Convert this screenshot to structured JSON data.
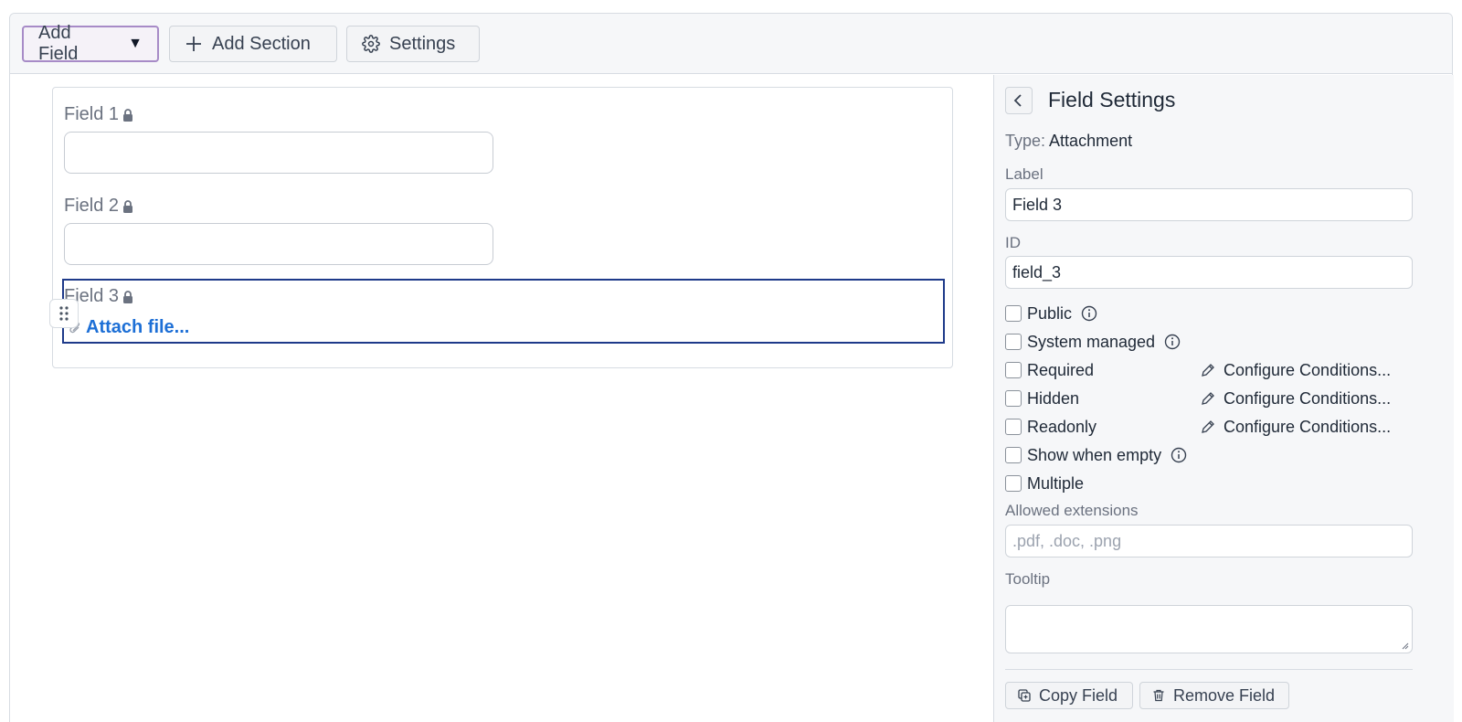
{
  "toolbar": {
    "add_field_label": "Add Field",
    "add_section_label": "Add Section",
    "settings_label": "Settings"
  },
  "form": {
    "fields": [
      {
        "label": "Field 1",
        "type": "text"
      },
      {
        "label": "Field 2",
        "type": "text"
      },
      {
        "label": "Field 3",
        "type": "attachment",
        "attach_link": "Attach file..."
      }
    ]
  },
  "panel": {
    "title": "Field Settings",
    "type_key": "Type:",
    "type_value": "Attachment",
    "label_caption": "Label",
    "label_value": "Field 3",
    "id_caption": "ID",
    "id_value": "field_3",
    "checkboxes": {
      "public": "Public",
      "system_managed": "System managed",
      "required": "Required",
      "hidden": "Hidden",
      "readonly": "Readonly",
      "show_when_empty": "Show when empty",
      "multiple": "Multiple"
    },
    "configure_conditions_label": "Configure Conditions...",
    "allowed_extensions_caption": "Allowed extensions",
    "allowed_extensions_placeholder": ".pdf, .doc, .png",
    "tooltip_caption": "Tooltip",
    "copy_field_label": "Copy Field",
    "remove_field_label": "Remove Field"
  },
  "colors": {
    "selected_border": "#1e3a8a",
    "link": "#1d6fd6",
    "add_field_border": "#a78bc7"
  }
}
